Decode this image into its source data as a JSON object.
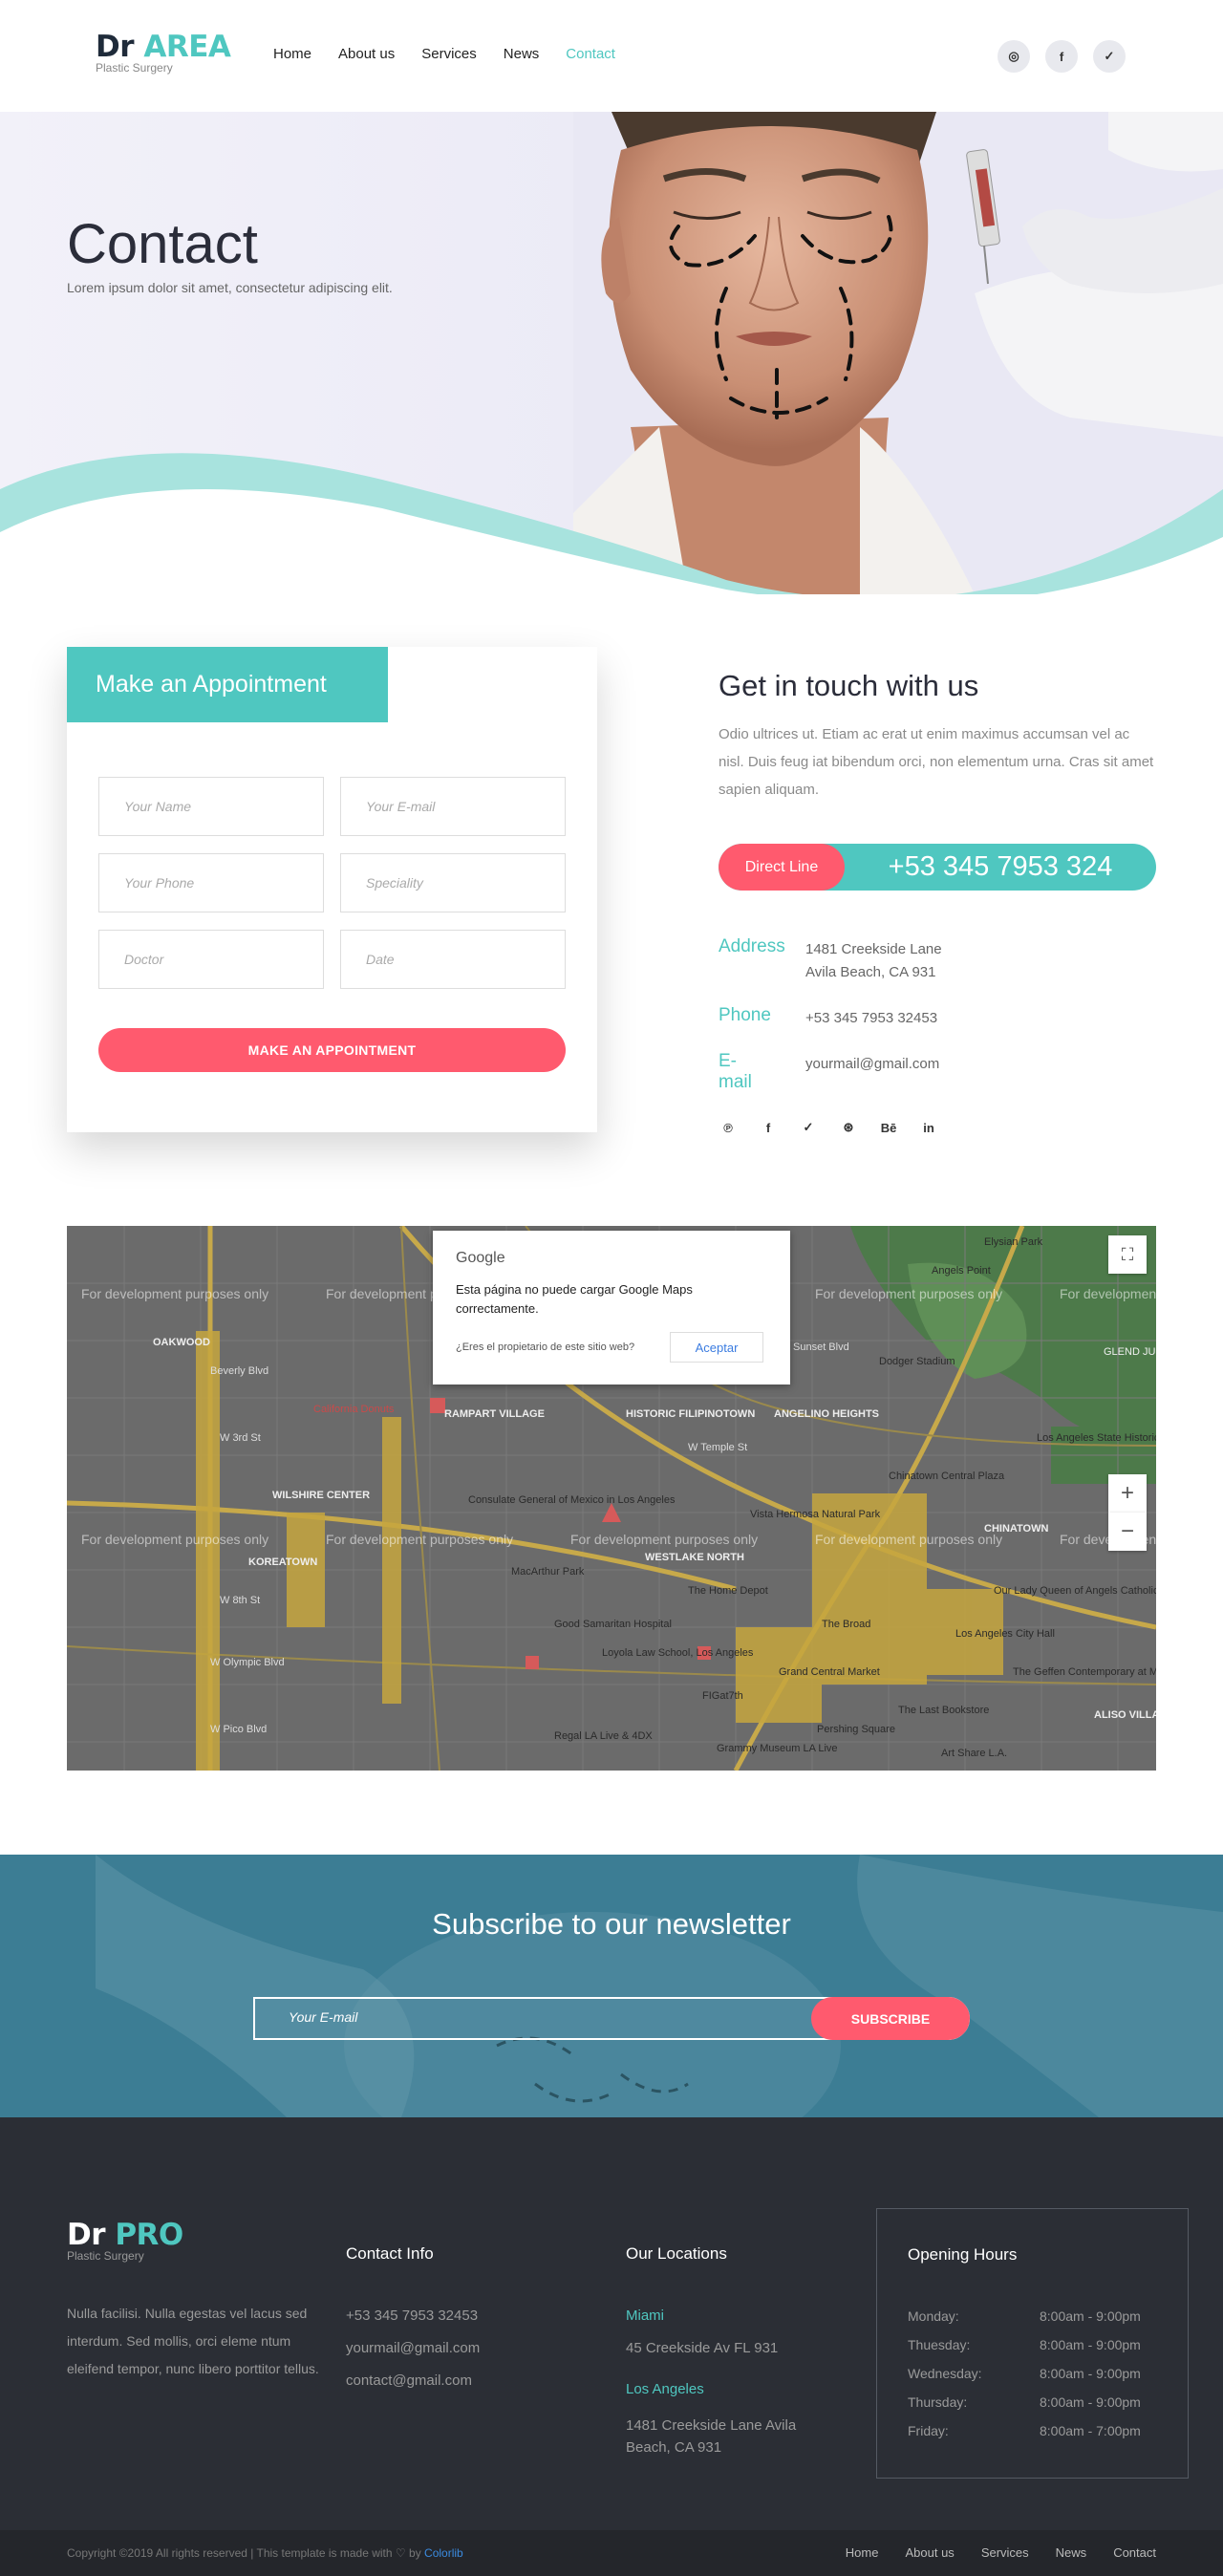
{
  "header": {
    "logo_dr": "Dr",
    "logo_area": "AREA",
    "logo_sub": "Plastic Surgery",
    "nav": [
      "Home",
      "About us",
      "Services",
      "News",
      "Contact"
    ],
    "active_nav": "Contact",
    "social": [
      "instagram-icon",
      "facebook-icon",
      "twitter-icon"
    ],
    "social_glyphs": [
      "◎",
      "f",
      "✓"
    ]
  },
  "hero": {
    "title": "Contact",
    "subtitle": "Lorem ipsum dolor sit amet, consectetur adipiscing elit."
  },
  "appointment": {
    "title": "Make an Appointment",
    "fields": {
      "name": "Your Name",
      "email": "Your E-mail",
      "phone": "Your Phone",
      "speciality": "Speciality",
      "doctor": "Doctor",
      "date": "Date"
    },
    "button": "MAKE AN APPOINTMENT"
  },
  "touch": {
    "title": "Get in touch with us",
    "text": "Odio ultrices ut. Etiam ac erat ut enim maximus accumsan vel ac nisl. Duis feug iat bibendum orci, non elementum urna. Cras sit amet sapien aliquam.",
    "direct_label": "Direct Line",
    "direct_number": "+53 345 7953 324",
    "address_label": "Address",
    "address_line1": "1481 Creekside Lane",
    "address_line2": "Avila Beach, CA 931",
    "phone_label": "Phone",
    "phone_value": "+53 345 7953 32453",
    "email_label": "E-mail",
    "email_value": "yourmail@gmail.com",
    "social": [
      "pinterest-icon",
      "facebook-icon",
      "twitter-icon",
      "dribbble-icon",
      "behance-icon",
      "linkedin-icon"
    ],
    "social_glyphs": [
      "℗",
      "f",
      "✓",
      "⊛",
      "Bē",
      "in"
    ]
  },
  "map": {
    "dev_text": "For development purposes only",
    "dialog_brand": "Google",
    "dialog_message": "Esta página no puede cargar Google Maps correctamente.",
    "dialog_question": "¿Eres el propietario de este sitio web?",
    "dialog_button": "Aceptar",
    "zoom_in": "+",
    "zoom_out": "−",
    "fullscreen": "⛶",
    "labels": [
      "Elysian Park",
      "Angels Point",
      "Dodger Stadium",
      "GLEND JUNCT",
      "OAKWOOD",
      "California Donuts",
      "RAMPART VILLAGE",
      "HISTORIC FILIPINOTOWN",
      "ANGELINO HEIGHTS",
      "Los Angeles State Historic Park",
      "Chinatown Central Plaza",
      "WILSHIRE CENTER",
      "Consulate General of Mexico in Los Angeles",
      "Vista Hermosa Natural Park",
      "CHINATOWN",
      "KOREATOWN",
      "MacArthur Park",
      "WESTLAKE NORTH",
      "The Home Depot",
      "Our Lady Queen of Angels Catholic Church",
      "Good Samaritan Hospital",
      "The Broad",
      "Los Angeles City Hall",
      "Loyola Law School, Los Angeles",
      "Grand Central Market",
      "The Geffen Contemporary at MOCA",
      "FIGat7th",
      "The Last Bookstore",
      "Regal LA Live & 4DX",
      "Pershing Square",
      "ALISO VILLA",
      "Grammy Museum LA Live",
      "Art Share L.A.",
      "W Olympic Blvd",
      "W Pico Blvd",
      "W 3rd St",
      "W 8th St",
      "W Temple St",
      "Beverly Blvd",
      "Sunset Blvd"
    ]
  },
  "newsletter": {
    "title": "Subscribe to our newsletter",
    "placeholder": "Your E-mail",
    "button": "SUBSCRIBE"
  },
  "footer": {
    "logo_dr": "Dr",
    "logo_pro": "PRO",
    "logo_sub": "Plastic Surgery",
    "about": "Nulla facilisi. Nulla egestas vel lacus sed interdum. Sed mollis, orci eleme ntum eleifend tempor, nunc libero porttitor tellus.",
    "contact_title": "Contact Info",
    "contact_lines": [
      "+53 345 7953 32453",
      "yourmail@gmail.com",
      "contact@gmail.com"
    ],
    "locations_title": "Our Locations",
    "city1": "Miami",
    "city1_addr": "45 Creekside Av FL 931",
    "city2": "Los Angeles",
    "city2_addr1": "1481 Creekside Lane Avila",
    "city2_addr2": "Beach, CA 931",
    "hours_title": "Opening Hours",
    "hours": [
      {
        "day": "Monday:",
        "time": "8:00am - 9:00pm"
      },
      {
        "day": "Thuesday:",
        "time": "8:00am - 9:00pm"
      },
      {
        "day": "Wednesday:",
        "time": "8:00am - 9:00pm"
      },
      {
        "day": "Thursday:",
        "time": "8:00am - 9:00pm"
      },
      {
        "day": "Friday:",
        "time": "8:00am - 7:00pm"
      }
    ],
    "copyright_pre": "Copyright ©2019 All rights reserved | This template is made with",
    "copyright_by": "by",
    "copyright_link": "Colorlib",
    "nav": [
      "Home",
      "About us",
      "Services",
      "News",
      "Contact"
    ]
  },
  "colors": {
    "accent": "#4fc7c0",
    "cta": "#ff5a6e",
    "footer_bg": "#2b2e35",
    "newsletter_bg": "#3c7d94"
  }
}
